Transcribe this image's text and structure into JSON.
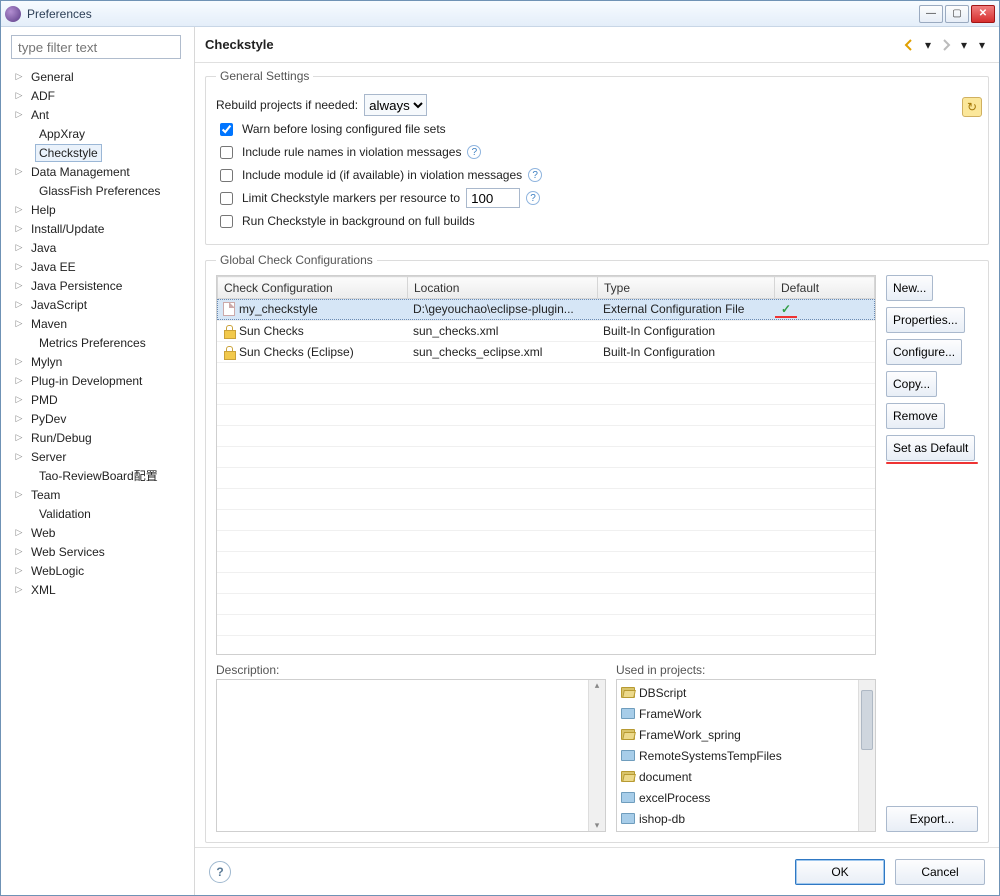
{
  "window": {
    "title": "Preferences"
  },
  "filter_placeholder": "type filter text",
  "tree": [
    {
      "label": "General",
      "exp": true
    },
    {
      "label": "ADF",
      "exp": true
    },
    {
      "label": "Ant",
      "exp": true
    },
    {
      "label": "AppXray",
      "child": true
    },
    {
      "label": "Checkstyle",
      "child": true,
      "selected": true
    },
    {
      "label": "Data Management",
      "exp": true
    },
    {
      "label": "GlassFish Preferences",
      "child": true
    },
    {
      "label": "Help",
      "exp": true
    },
    {
      "label": "Install/Update",
      "exp": true
    },
    {
      "label": "Java",
      "exp": true
    },
    {
      "label": "Java EE",
      "exp": true
    },
    {
      "label": "Java Persistence",
      "exp": true
    },
    {
      "label": "JavaScript",
      "exp": true
    },
    {
      "label": "Maven",
      "exp": true
    },
    {
      "label": "Metrics Preferences",
      "child": true
    },
    {
      "label": "Mylyn",
      "exp": true
    },
    {
      "label": "Plug-in Development",
      "exp": true
    },
    {
      "label": "PMD",
      "exp": true
    },
    {
      "label": "PyDev",
      "exp": true
    },
    {
      "label": "Run/Debug",
      "exp": true
    },
    {
      "label": "Server",
      "exp": true
    },
    {
      "label": "Tao-ReviewBoard配置",
      "child": true
    },
    {
      "label": "Team",
      "exp": true
    },
    {
      "label": "Validation",
      "child": true
    },
    {
      "label": "Web",
      "exp": true
    },
    {
      "label": "Web Services",
      "exp": true
    },
    {
      "label": "WebLogic",
      "exp": true
    },
    {
      "label": "XML",
      "exp": true
    }
  ],
  "page_title": "Checkstyle",
  "general": {
    "legend": "General Settings",
    "rebuild_label": "Rebuild projects if needed:",
    "rebuild_value": "always",
    "warn": {
      "checked": true,
      "label": "Warn before losing configured file sets"
    },
    "include_rule": {
      "checked": false,
      "label": "Include rule names in violation messages"
    },
    "include_mod": {
      "checked": false,
      "label": "Include module id (if available) in violation messages"
    },
    "limit": {
      "checked": false,
      "label": "Limit Checkstyle markers per resource to",
      "value": "100"
    },
    "run_bg": {
      "checked": false,
      "label": "Run Checkstyle in background on full builds"
    }
  },
  "configs": {
    "legend": "Global Check Configurations",
    "cols": [
      "Check Configuration",
      "Location",
      "Type",
      "Default"
    ],
    "rows": [
      {
        "icon": "file",
        "name": "my_checkstyle",
        "loc": "D:\\geyouchao\\eclipse-plugin...",
        "type": "External Configuration File",
        "default": true,
        "selected": true
      },
      {
        "icon": "lock",
        "name": "Sun Checks",
        "loc": "sun_checks.xml",
        "type": "Built-In Configuration",
        "default": false
      },
      {
        "icon": "lock",
        "name": "Sun Checks (Eclipse)",
        "loc": "sun_checks_eclipse.xml",
        "type": "Built-In Configuration",
        "default": false
      }
    ],
    "buttons": [
      "New...",
      "Properties...",
      "Configure...",
      "Copy...",
      "Remove",
      "Set as Default"
    ]
  },
  "description_label": "Description:",
  "used_label": "Used in projects:",
  "projects": [
    {
      "name": "DBScript",
      "open": true
    },
    {
      "name": "FrameWork",
      "open": false
    },
    {
      "name": "FrameWork_spring",
      "open": true
    },
    {
      "name": "RemoteSystemsTempFiles",
      "open": false
    },
    {
      "name": "document",
      "open": true
    },
    {
      "name": "excelProcess",
      "open": false
    },
    {
      "name": "ishop-db",
      "open": false
    }
  ],
  "export_label": "Export...",
  "footer": {
    "ok": "OK",
    "cancel": "Cancel"
  }
}
